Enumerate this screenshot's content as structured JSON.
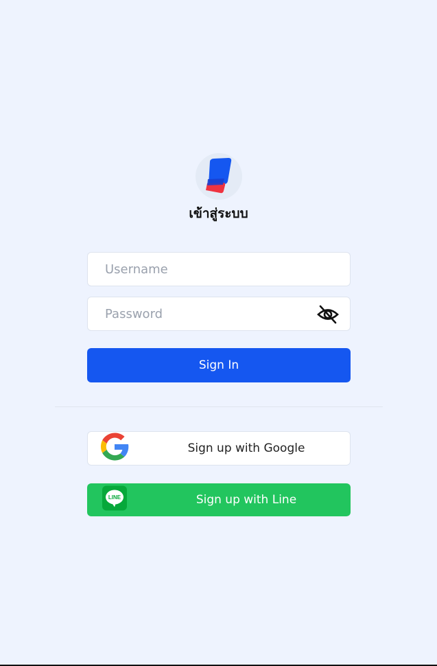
{
  "app": {
    "logo_icon": "brand-logo-icon",
    "title": "เข้าสู่ระบบ"
  },
  "form": {
    "username_placeholder": "Username",
    "password_placeholder": "Password",
    "password_toggle_icon": "eye-slash-icon",
    "signin_label": "Sign In"
  },
  "social": {
    "google_label": "Sign up with Google",
    "google_icon": "google-icon",
    "line_label": "Sign up with Line",
    "line_icon": "line-icon",
    "line_icon_text": "LINE"
  },
  "colors": {
    "background": "#eef3fe",
    "primary": "#1557f0",
    "line_green": "#22c55e"
  }
}
